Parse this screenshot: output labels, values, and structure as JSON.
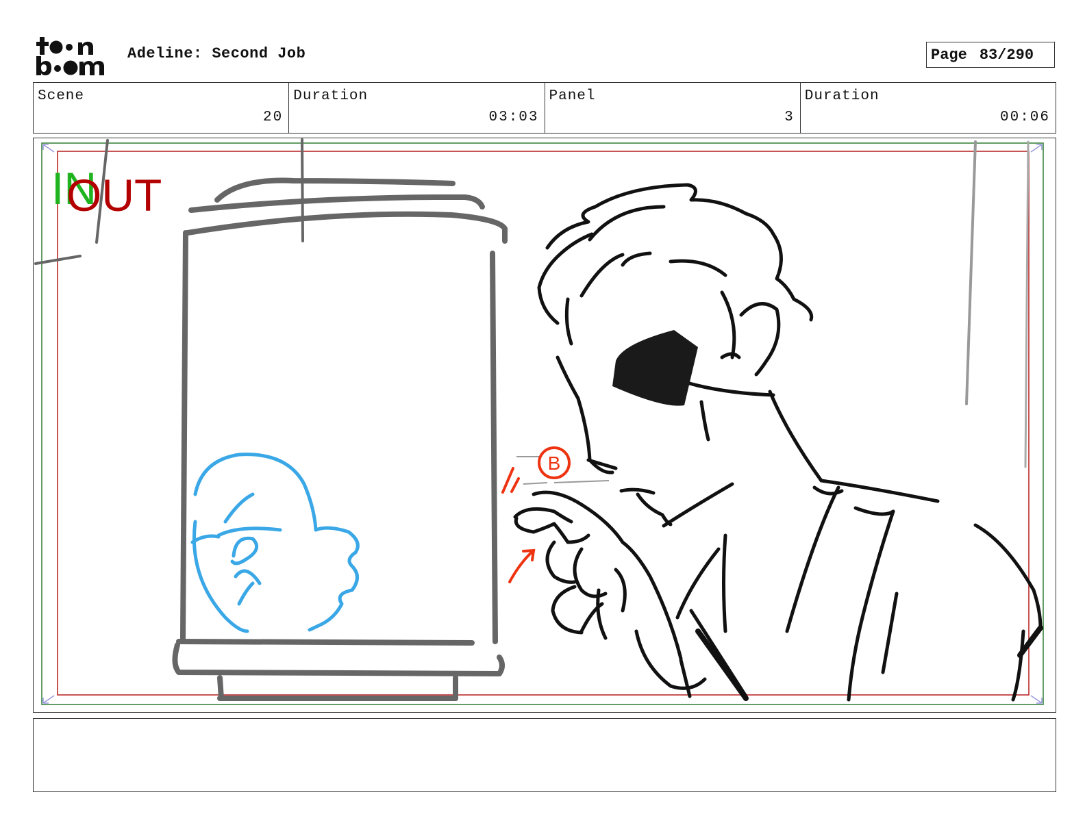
{
  "header": {
    "logo_text": "toon boom",
    "title": "Adeline: Second Job",
    "page_label": "Page",
    "page_number": "83/290"
  },
  "info": {
    "scene_label": "Scene",
    "scene_value": "20",
    "scene_duration_label": "Duration",
    "scene_duration_value": "03:03",
    "panel_label": "Panel",
    "panel_value": "3",
    "panel_duration_label": "Duration",
    "panel_duration_value": "00:06"
  },
  "panel_markers": {
    "in_label": "IN",
    "out_label": "OUT",
    "annotation_label": "B",
    "in_color": "#1fb31f",
    "out_color": "#b30000",
    "annotation_color": "#ee3311",
    "character_sketch_color": "#3aa7e6"
  },
  "caption": {
    "text": ""
  }
}
